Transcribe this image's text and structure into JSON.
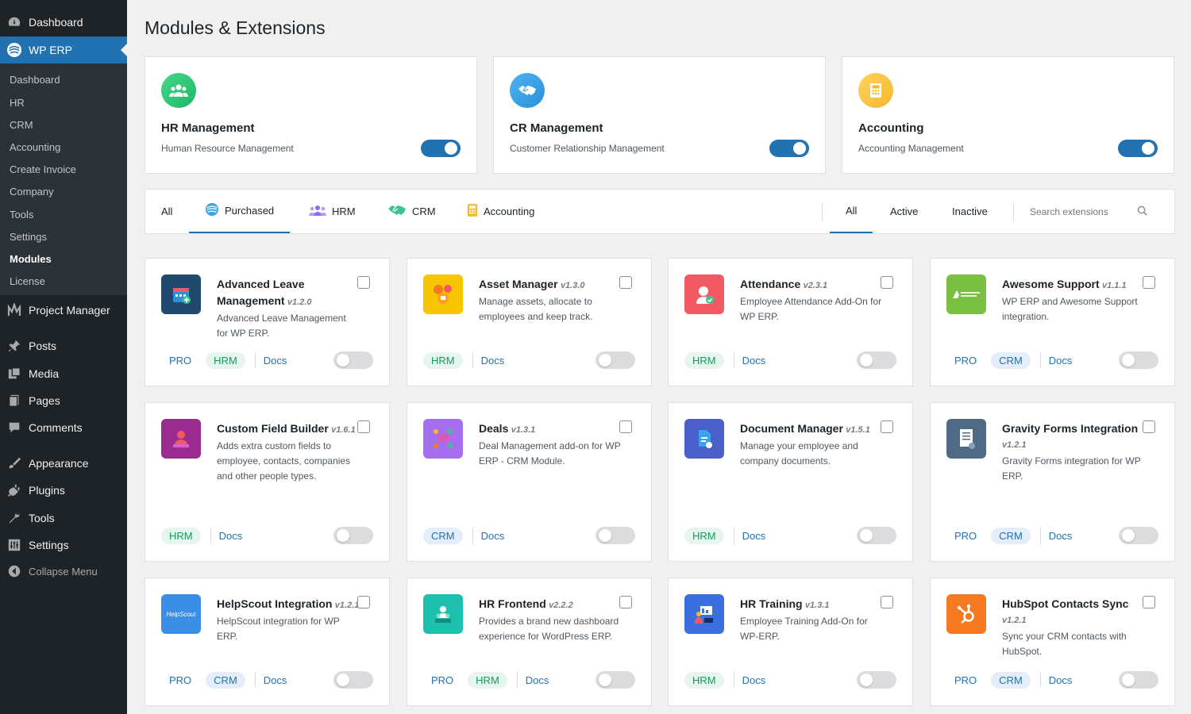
{
  "sidebar": {
    "top": [
      {
        "label": "Dashboard",
        "icon": "dashboard-icon"
      },
      {
        "label": "WP ERP",
        "icon": "wperp-icon"
      }
    ],
    "submenu": [
      "Dashboard",
      "HR",
      "CRM",
      "Accounting",
      "Create Invoice",
      "Company",
      "Tools",
      "Settings",
      "Modules",
      "License"
    ],
    "bottom": [
      {
        "label": "Project Manager",
        "icon": "project-manager-icon"
      },
      {
        "label": "Posts",
        "icon": "pin-icon"
      },
      {
        "label": "Media",
        "icon": "media-icon"
      },
      {
        "label": "Pages",
        "icon": "pages-icon"
      },
      {
        "label": "Comments",
        "icon": "comment-icon"
      },
      {
        "label": "Appearance",
        "icon": "brush-icon"
      },
      {
        "label": "Plugins",
        "icon": "plugin-icon"
      },
      {
        "label": "Tools",
        "icon": "wrench-icon"
      },
      {
        "label": "Settings",
        "icon": "settings-icon"
      },
      {
        "label": "Collapse Menu",
        "icon": "collapse-icon"
      }
    ]
  },
  "page_title": "Modules & Extensions",
  "modules": [
    {
      "title": "HR Management",
      "desc": "Human Resource Management",
      "enabled": true,
      "color": "#2ecc71"
    },
    {
      "title": "CR Management",
      "desc": "Customer Relationship Management",
      "enabled": true,
      "color": "#3498db"
    },
    {
      "title": "Accounting",
      "desc": "Accounting Management",
      "enabled": true,
      "color": "#f5b82e"
    }
  ],
  "filters": {
    "categories": [
      "All",
      "Purchased",
      "HRM",
      "CRM",
      "Accounting"
    ],
    "status": [
      "All",
      "Active",
      "Inactive"
    ],
    "search_placeholder": "Search extensions"
  },
  "extensions": [
    {
      "name": "Advanced Leave Management",
      "version": "v1.2.0",
      "desc": "Advanced Leave Management for WP ERP.",
      "pro": "PRO",
      "tag": "HRM",
      "docs": "Docs",
      "color": "#1f4a6e"
    },
    {
      "name": "Asset Manager",
      "version": "v1.3.0",
      "desc": "Manage assets, allocate to employees and keep track.",
      "pro": "",
      "tag": "HRM",
      "docs": "Docs",
      "color": "#f7c600"
    },
    {
      "name": "Attendance",
      "version": "v2.3.1",
      "desc": "Employee Attendance Add-On for WP ERP.",
      "pro": "",
      "tag": "HRM",
      "docs": "Docs",
      "color": "#f25a63"
    },
    {
      "name": "Awesome Support",
      "version": "v1.1.1",
      "desc": "WP ERP and Awesome Support integration.",
      "pro": "PRO",
      "tag": "CRM",
      "docs": "Docs",
      "color": "#7ac143"
    },
    {
      "name": "Custom Field Builder",
      "version": "v1.6.1",
      "desc": "Adds extra custom fields to employee, contacts, companies and other people types.",
      "pro": "",
      "tag": "HRM",
      "docs": "Docs",
      "color": "#9b2c8f"
    },
    {
      "name": "Deals",
      "version": "v1.3.1",
      "desc": "Deal Management add-on for WP ERP - CRM Module.",
      "pro": "",
      "tag": "CRM",
      "docs": "Docs",
      "color": "#a56ff0"
    },
    {
      "name": "Document Manager",
      "version": "v1.5.1",
      "desc": "Manage your employee and company documents.",
      "pro": "",
      "tag": "HRM",
      "docs": "Docs",
      "color": "#4a5fc9"
    },
    {
      "name": "Gravity Forms Integration",
      "version": "v1.2.1",
      "desc": "Gravity Forms integration for WP ERP.",
      "pro": "PRO",
      "tag": "CRM",
      "docs": "Docs",
      "color": "#4f6a85"
    },
    {
      "name": "HelpScout Integration",
      "version": "v1.2.1",
      "desc": "HelpScout integration for WP ERP.",
      "pro": "PRO",
      "tag": "CRM",
      "docs": "Docs",
      "color": "#3a8ee6",
      "logo_text": "HelpScout"
    },
    {
      "name": "HR Frontend",
      "version": "v2.2.2",
      "desc": "Provides a brand new dashboard experience for WordPress ERP.",
      "pro": "PRO",
      "tag": "HRM",
      "docs": "Docs",
      "color": "#1fbfae"
    },
    {
      "name": "HR Training",
      "version": "v1.3.1",
      "desc": "Employee Training Add-On for WP-ERP.",
      "pro": "",
      "tag": "HRM",
      "docs": "Docs",
      "color": "#3b6fe0"
    },
    {
      "name": "HubSpot Contacts Sync",
      "version": "v1.2.1",
      "desc": "Sync your CRM contacts with HubSpot.",
      "pro": "PRO",
      "tag": "CRM",
      "docs": "Docs",
      "color": "#f57a22"
    }
  ],
  "colors": {
    "accent": "#2271b1",
    "sidebar": "#1d2327",
    "hrm_badge": "#0f9d58",
    "crm_badge": "#2271b1"
  }
}
